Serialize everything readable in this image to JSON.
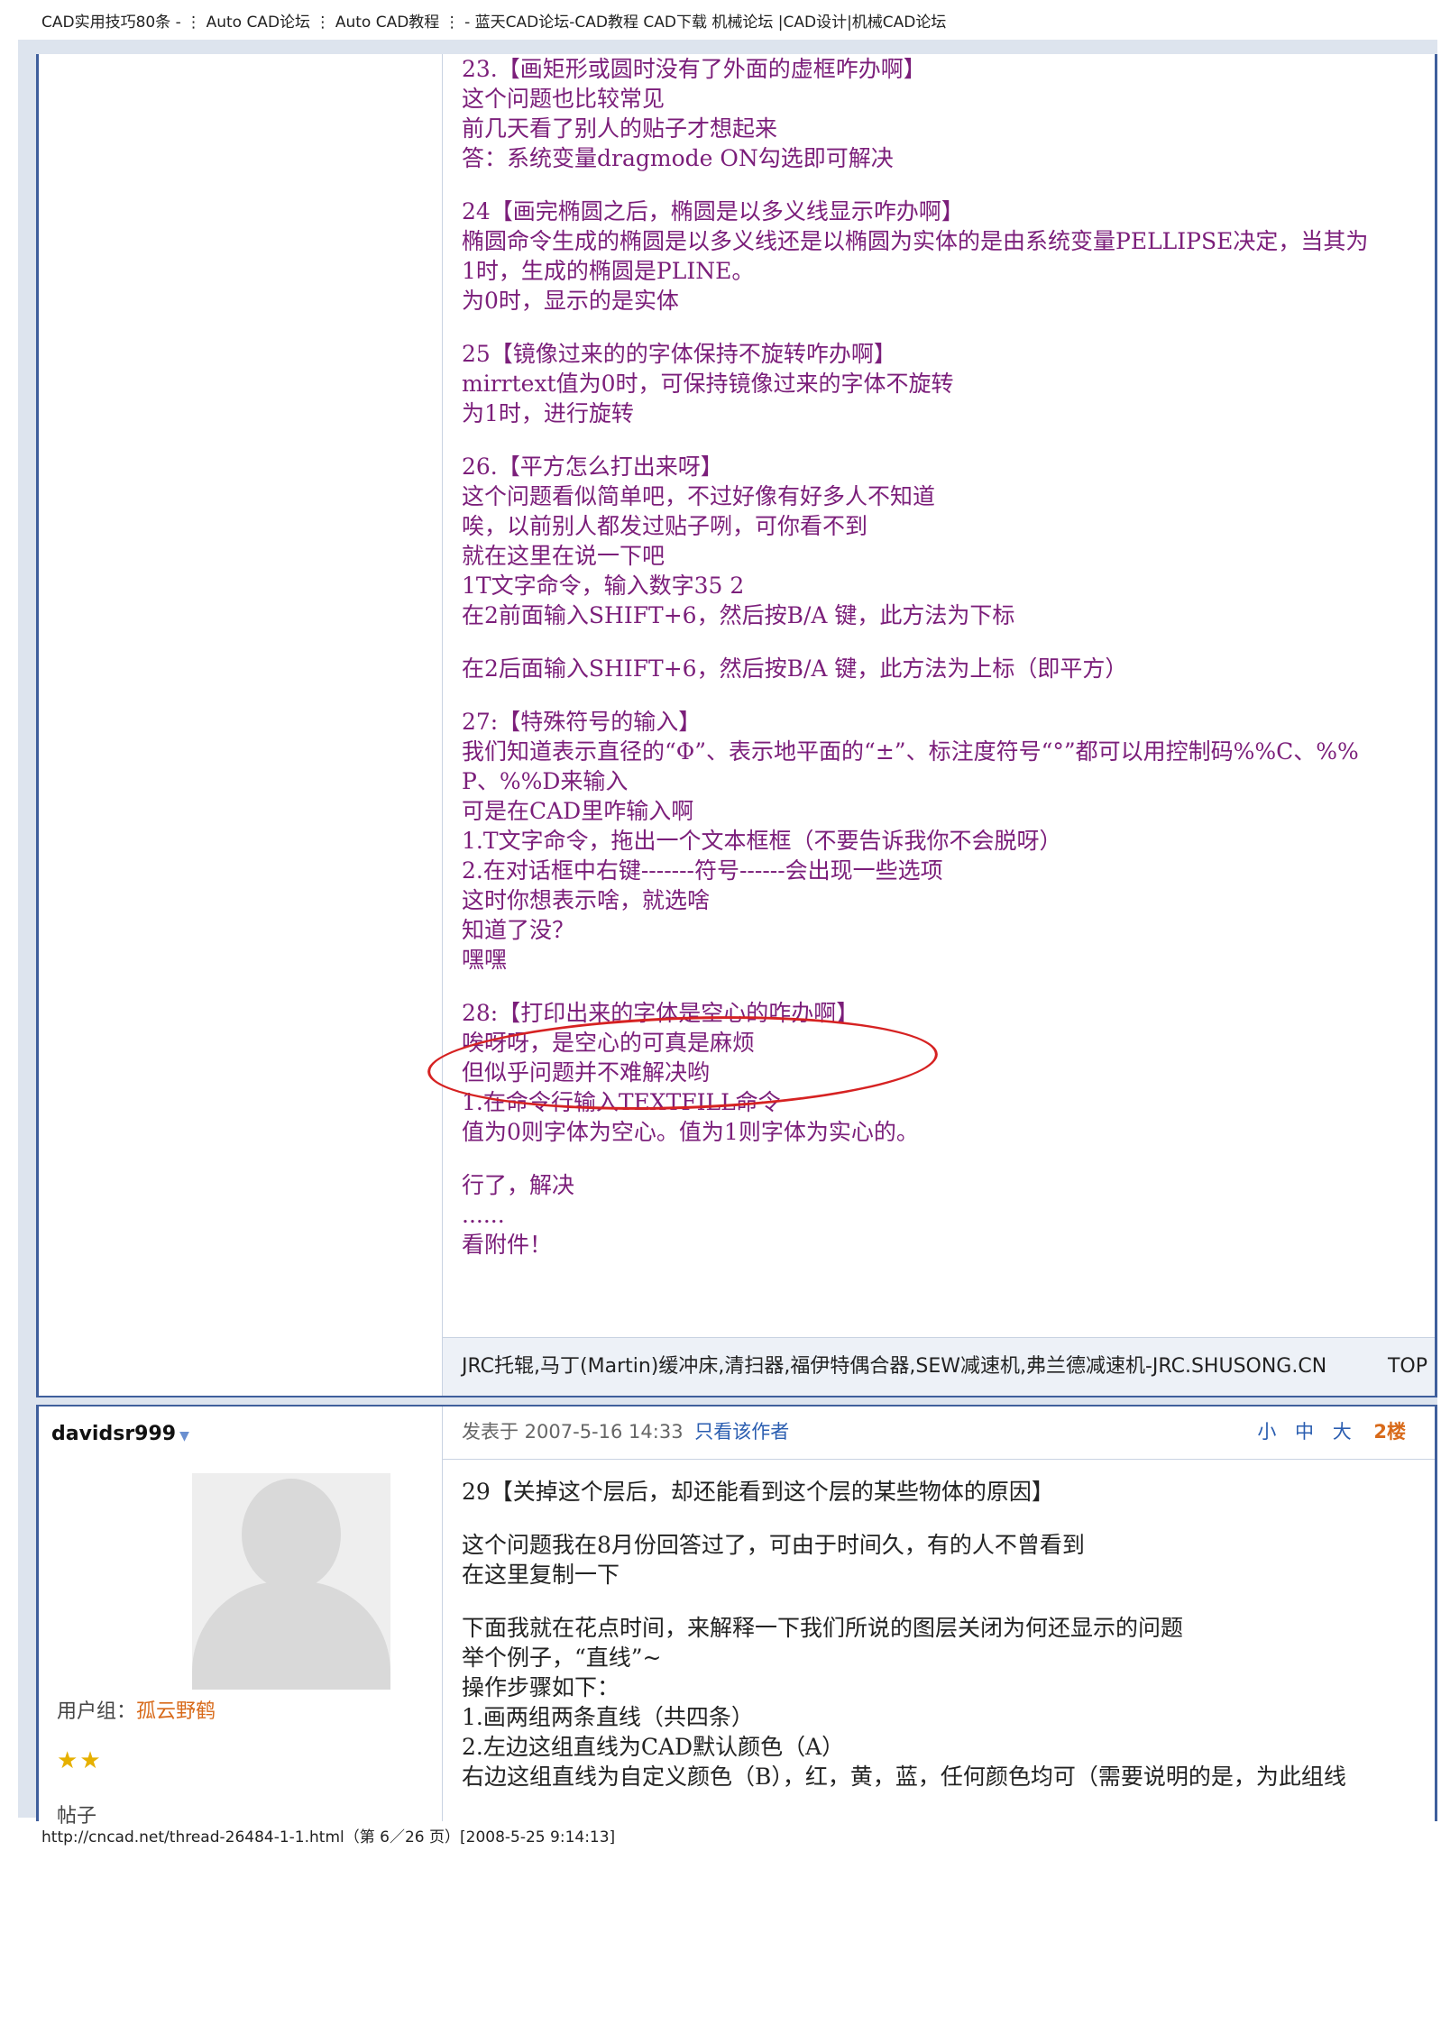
{
  "print_header": "CAD实用技巧80条 -  ⋮ Auto CAD论坛  ⋮ Auto CAD教程  ⋮  - 蓝天CAD论坛-CAD教程 CAD下载 机械论坛 |CAD设计|机械CAD论坛",
  "post1": {
    "paragraphs": [
      [
        "23.【画矩形或圆时没有了外面的虚框咋办啊】",
        "这个问题也比较常见",
        "前几天看了别人的贴子才想起来",
        "答：系统变量dragmode ON勾选即可解决"
      ],
      [
        "24【画完椭圆之后，椭圆是以多义线显示咋办啊】",
        "椭圆命令生成的椭圆是以多义线还是以椭圆为实体的是由系统变量PELLIPSE决定，当其为",
        "1时，生成的椭圆是PLINE。",
        "为0时，显示的是实体"
      ],
      [
        "25【镜像过来的的字体保持不旋转咋办啊】",
        "mirrtext值为0时，可保持镜像过来的字体不旋转",
        "为1时，进行旋转"
      ],
      [
        "26.【平方怎么打出来呀】",
        "这个问题看似简单吧，不过好像有好多人不知道",
        "唉，以前别人都发过贴子咧，可你看不到",
        "就在这里在说一下吧",
        "1T文字命令，输入数字35 2",
        "在2前面输入SHIFT+6，然后按B/A 键，此方法为下标"
      ],
      [
        "在2后面输入SHIFT+6，然后按B/A 键，此方法为上标（即平方）"
      ],
      [
        "27:【特殊符号的输入】",
        "   我们知道表示直径的“Φ”、表示地平面的“±”、标注度符号“°”都可以用控制码%%C、%%",
        "P、%%D来输入",
        "可是在CAD里咋输入啊",
        "1.T文字命令，拖出一个文本框框（不要告诉我你不会脱呀）",
        "2.在对话框中右键-------符号------会出现一些选项",
        "这时你想表示啥，就选啥",
        "知道了没？",
        "嘿嘿"
      ],
      [
        "28:【打印出来的字体是空心的咋办啊】",
        "唉呀呀，是空心的可真是麻烦",
        "但似乎问题并不难解决哟",
        "1.在命令行输入TEXTFILL命令",
        "值为0则字体为空心。值为1则字体为实心的。"
      ],
      [
        "行了，解决",
        "......",
        "看附件！"
      ]
    ],
    "signature": "JRC托辊,马丁(Martin)缓冲床,清扫器,福伊特偶合器,SEW减速机,弗兰德减速机-JRC.SHUSONG.CN",
    "top_link": "TOP"
  },
  "post2": {
    "username": "davidsr999",
    "usergroup_label": "用户组：",
    "usergroup_value": "孤云野鹤",
    "posts_label": "帖子",
    "posted_at": "发表于 2007-5-16 14:33",
    "author_only": "只看该作者",
    "font_small": "小",
    "font_medium": "中",
    "font_large": "大",
    "floor": "2楼",
    "paragraphs": [
      [
        "29【关掉这个层后，却还能看到这个层的某些物体的原因】"
      ],
      [
        "这个问题我在8月份回答过了，可由于时间久，有的人不曾看到",
        "在这里复制一下"
      ],
      [
        "下面我就在花点时间，来解释一下我们所说的图层关闭为何还显示的问题",
        "举个例子，“直线”~",
        "操作步骤如下：",
        "1.画两组两条直线（共四条）",
        "2.左边这组直线为CAD默认颜色（A）",
        "右边这组直线为自定义颜色（B），红，黄，蓝，任何颜色均可（需要说明的是，为此组线"
      ]
    ]
  },
  "print_footer": "http://cncad.net/thread-26484-1-1.html（第 6／26 页）[2008-5-25 9:14:13]"
}
